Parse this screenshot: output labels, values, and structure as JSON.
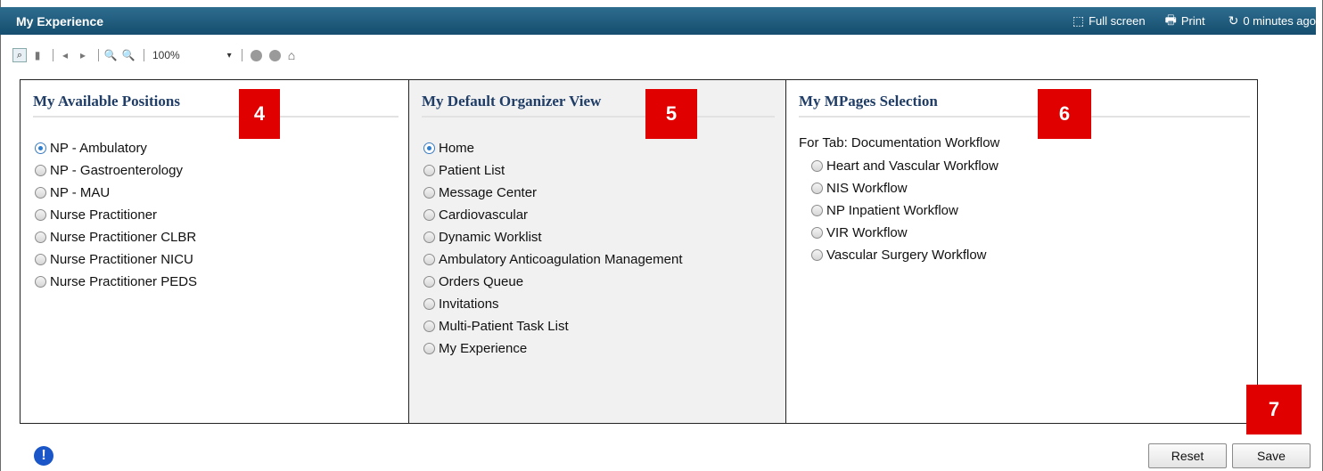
{
  "titlebar": {
    "title": "My Experience",
    "full_screen": "Full screen",
    "print": "Print",
    "refresh": "0 minutes ago"
  },
  "toolbar": {
    "zoom": "100%"
  },
  "columns": {
    "positions": {
      "title": "My Available Positions",
      "selected": "NP - Ambulatory",
      "items": [
        "NP - Ambulatory",
        "NP - Gastroenterology",
        "NP - MAU",
        "Nurse Practitioner",
        "Nurse Practitioner CLBR",
        "Nurse Practitioner NICU",
        "Nurse Practitioner PEDS"
      ]
    },
    "organizer": {
      "title": "My Default Organizer View",
      "selected": "Home",
      "items": [
        "Home",
        "Patient List",
        "Message Center",
        "Cardiovascular",
        "Dynamic Worklist",
        "Ambulatory Anticoagulation Management",
        "Orders Queue",
        "Invitations",
        "Multi-Patient Task List",
        "My Experience"
      ]
    },
    "mpages": {
      "title": "My MPages Selection",
      "for_tab": "For Tab:  Documentation Workflow",
      "items": [
        "Heart and Vascular Workflow",
        "NIS Workflow",
        "NP Inpatient Workflow",
        "VIR Workflow",
        "Vascular Surgery Workflow"
      ]
    }
  },
  "badges": {
    "b4": "4",
    "b5": "5",
    "b6": "6",
    "b7": "7"
  },
  "buttons": {
    "reset": "Reset",
    "save": "Save"
  },
  "colors": {
    "titlebar": "#154e6e",
    "badge": "#e00000",
    "heading": "#1f3d66"
  }
}
